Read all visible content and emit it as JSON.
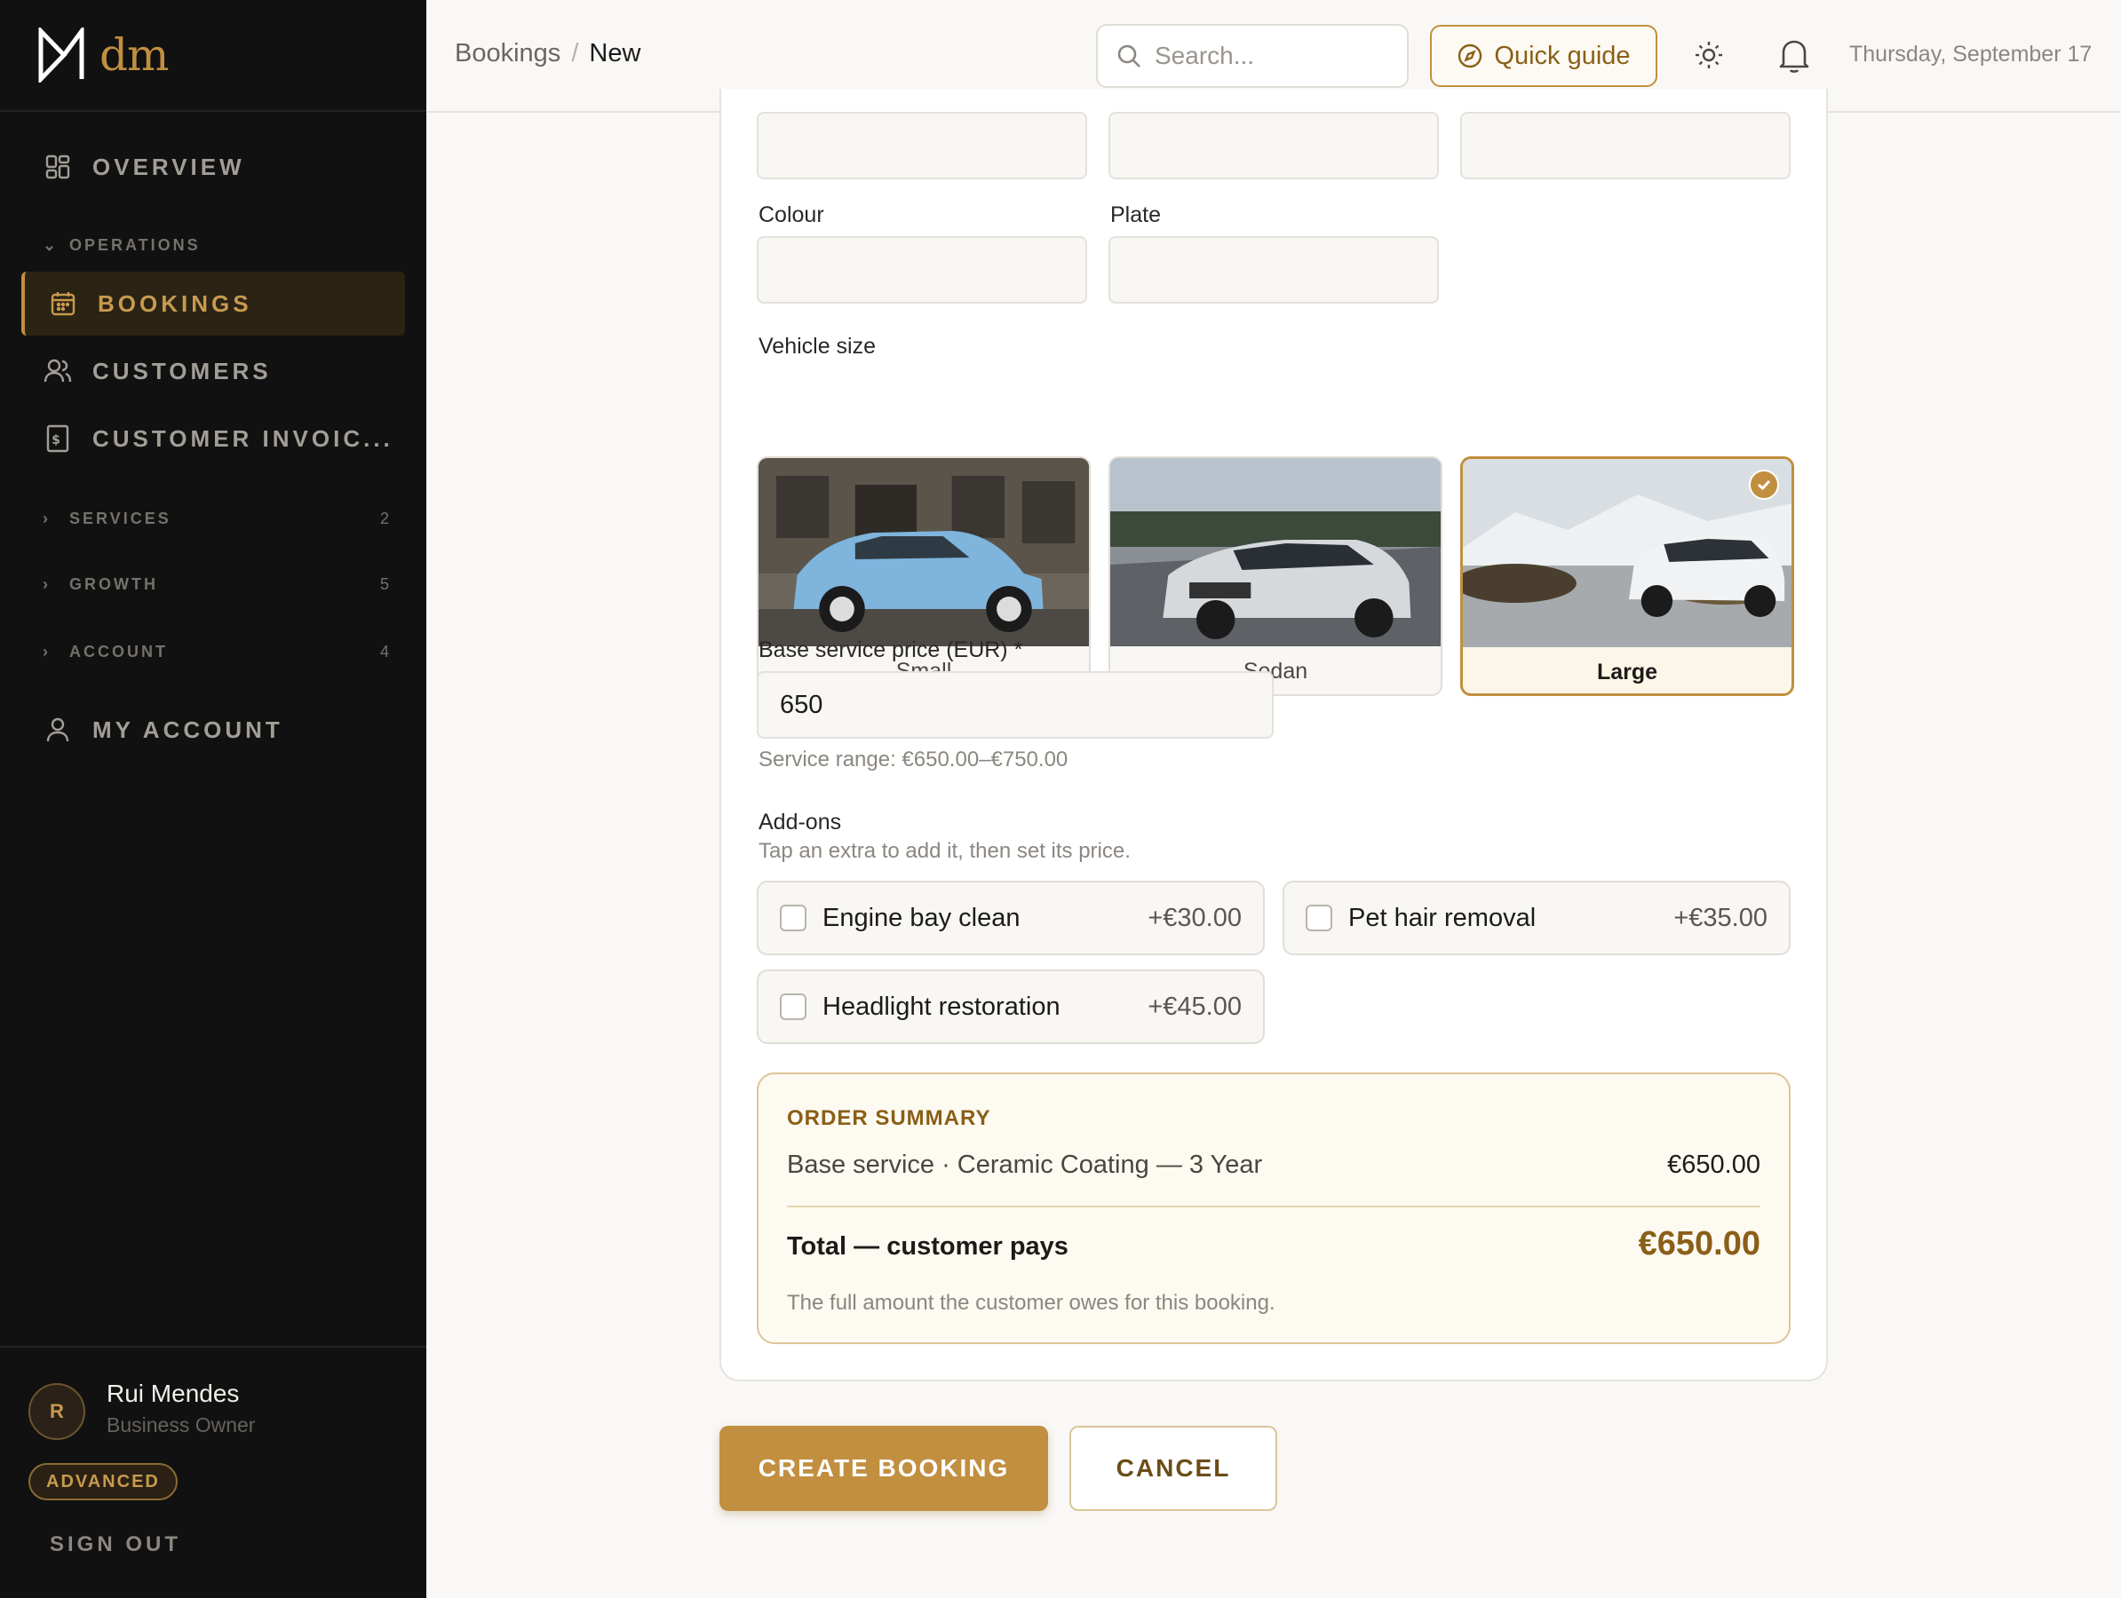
{
  "app": {
    "logo_text": "dm"
  },
  "sidebar": {
    "overview": "OVERVIEW",
    "operations_section": "OPERATIONS",
    "bookings": "BOOKINGS",
    "customers": "CUSTOMERS",
    "customer_invoices": "CUSTOMER INVOIC...",
    "services": {
      "label": "SERVICES",
      "count": "2"
    },
    "growth": {
      "label": "GROWTH",
      "count": "5"
    },
    "account": {
      "label": "ACCOUNT",
      "count": "4"
    },
    "my_account": "MY ACCOUNT",
    "user": {
      "initial": "R",
      "name": "Rui Mendes",
      "role": "Business Owner",
      "plan_badge": "ADVANCED"
    },
    "sign_out": "SIGN OUT"
  },
  "header": {
    "breadcrumb": {
      "parent": "Bookings",
      "separator": "/",
      "current": "New"
    },
    "search_placeholder": "Search...",
    "quick_guide": "Quick guide",
    "date": "Thursday, September 17"
  },
  "form": {
    "colour_label": "Colour",
    "plate_label": "Plate",
    "vehicle_size_label": "Vehicle size",
    "vehicle_sizes": [
      {
        "label": "Small",
        "selected": false
      },
      {
        "label": "Sedan",
        "selected": false
      },
      {
        "label": "Large",
        "selected": true
      }
    ],
    "base_price_label": "Base service price (EUR) *",
    "base_price_value": "650",
    "service_range": "Service range: €650.00–€750.00",
    "addons_label": "Add-ons",
    "addons_hint": "Tap an extra to add it, then set its price.",
    "addons": [
      {
        "name": "Engine bay clean",
        "price": "+€30.00",
        "checked": false
      },
      {
        "name": "Pet hair removal",
        "price": "+€35.00",
        "checked": false
      },
      {
        "name": "Headlight restoration",
        "price": "+€45.00",
        "checked": false
      }
    ]
  },
  "summary": {
    "title": "ORDER SUMMARY",
    "line_label": "Base service · Ceramic Coating — 3 Year",
    "line_amount": "€650.00",
    "total_label": "Total — customer pays",
    "total_amount": "€650.00",
    "note": "The full amount the customer owes for this booking."
  },
  "actions": {
    "create": "CREATE BOOKING",
    "cancel": "CANCEL"
  },
  "colors": {
    "accent": "#c18f3f",
    "sidebar_bg": "#111111",
    "page_bg": "#f9f8f6"
  }
}
